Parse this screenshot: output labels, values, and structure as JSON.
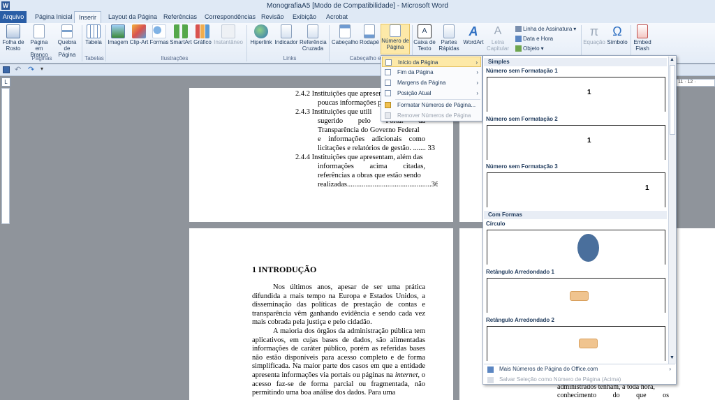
{
  "window": {
    "title": "MonografiaA5 [Modo de Compatibilidade] - Microsoft Word",
    "app_icon": "W"
  },
  "tabs": [
    "Arquivo",
    "Página Inicial",
    "Inserir",
    "Layout da Página",
    "Referências",
    "Correspondências",
    "Revisão",
    "Exibição",
    "Acrobat"
  ],
  "ribbon": {
    "paginas": {
      "folha_rosto": "Folha de Rosto",
      "pagina_branco": "Página em Branco",
      "quebra_pagina": "Quebra de Página",
      "group": "Páginas"
    },
    "tabelas": {
      "tabela": "Tabela",
      "group": "Tabelas"
    },
    "ilustracoes": {
      "imagem": "Imagem",
      "clipart": "Clip-Art",
      "formas": "Formas",
      "smartart": "SmartArt",
      "grafico": "Gráfico",
      "instantaneo": "Instantâneo",
      "group": "Ilustrações"
    },
    "links": {
      "hiperlink": "Hiperlink",
      "indicador": "Indicador",
      "referencia_cruzada": "Referência Cruzada",
      "group": "Links"
    },
    "cabecalho_rodape": {
      "cabecalho": "Cabeçalho",
      "rodape": "Rodapé",
      "numero_pagina": "Número de Página",
      "group": "Cabeçalho e R"
    },
    "texto": {
      "caixa_texto": "Caixa de Texto",
      "partes_rapidas": "Partes Rápidas",
      "wordart": "WordArt",
      "letra_capitular": "Letra Capitular",
      "linha_assinatura": "Linha de Assinatura",
      "data_hora": "Data e Hora",
      "objeto": "Objeto"
    },
    "simbolos": {
      "equacao": "Equação",
      "simbolo": "Símbolo"
    },
    "flash": {
      "embed": "Embed Flash"
    }
  },
  "ruler_right": "11 · 12 ·",
  "doc": {
    "toc": [
      {
        "num": "2.4.2",
        "text": "Instituições que apresen",
        "cont": "poucas informações p"
      },
      {
        "num": "2.4.3",
        "text": "Instituições que utili",
        "cont2": "sugerido pelo Portal da",
        "cont3": "Transparência do Governo Federal",
        "cont4": "e informações adicionais como",
        "cont5": "licitações e relatórios de gestão. ....... 33"
      },
      {
        "num": "2.4.4",
        "text": "Instituições que apresentam, além das",
        "cont2": "informações acima citadas,",
        "cont3": "referências a obras que estão sendo",
        "cont4": "realizadas.",
        "page": "36"
      }
    ],
    "heading": "1 INTRODUÇÃO",
    "para1": "Nos últimos anos, apesar de ser uma prática difundida a mais tempo na Europa e Estados Unidos, a disseminação das políticas de prestação de contas e transparência vêm ganhando evidência e sendo cada vez mais cobrada pela justiça e pelo cidadão.",
    "para2_a": "A maioria dos órgãos da administração pública tem aplicativos, em cujas bases de dados, são alimentadas informações de caráter público, porém as referidas bases não estão disponíveis para acesso completo e de forma simplificada. Na maior parte dos casos em que a entidade apresenta informações via portais ou páginas na ",
    "para2_it": "internet",
    "para2_b": ", o acesso faz-se de forma parcial ou fragmentada, não permitindo uma boa análise dos dados. Para uma",
    "right_frag1": "administrados tenham, a toda hora,",
    "right_frag2": "conhecimento do que os"
  },
  "menu": {
    "items": [
      {
        "label": "Início da Página",
        "arrow": "›"
      },
      {
        "label": "Fim da Página",
        "arrow": "›"
      },
      {
        "label": "Margens da Página",
        "arrow": "›"
      },
      {
        "label": "Posição Atual",
        "arrow": "›"
      },
      {
        "label": "Formatar Números de Página..."
      },
      {
        "label": "Remover Números de Página"
      }
    ]
  },
  "gallery": {
    "section1": "Simples",
    "items1": [
      {
        "label": "Número sem Formatação 1",
        "num": "1"
      },
      {
        "label": "Número sem Formatação 2",
        "num": "1"
      },
      {
        "label": "Número sem Formatação 3",
        "num": "1"
      }
    ],
    "section2": "Com Formas",
    "items2": [
      {
        "label": "Círculo"
      },
      {
        "label": "Retângulo Arredondado 1"
      },
      {
        "label": "Retângulo Arredondado 2"
      }
    ],
    "more": "Mais Números de Página do Office.com",
    "save": "Salvar Seleção como Número de Página (Acima)"
  },
  "colors": {
    "accent": "#2a5ea6",
    "highlight": "#fde9a8",
    "circle": "#4a6f9c",
    "rounded": "#f0c48f"
  }
}
